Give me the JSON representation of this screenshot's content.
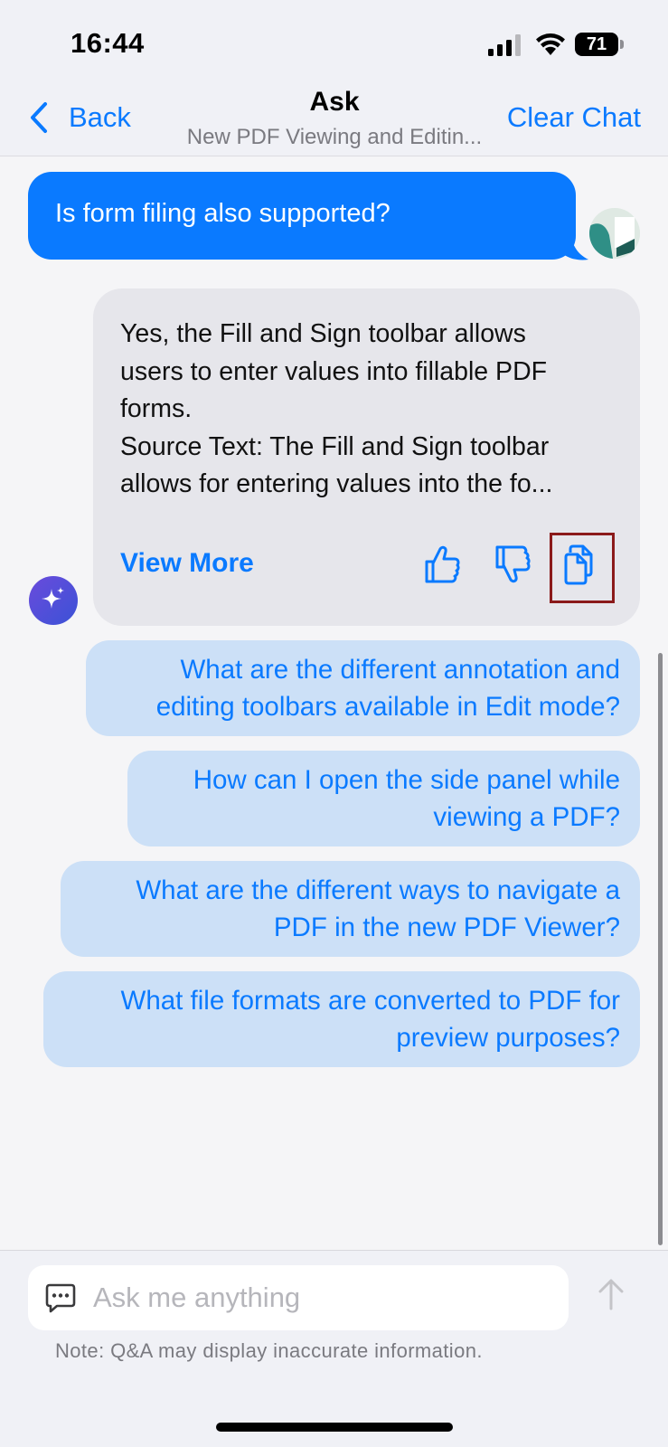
{
  "status": {
    "time": "16:44",
    "battery": "71"
  },
  "nav": {
    "back_label": "Back",
    "title": "Ask",
    "subtitle": "New PDF Viewing and Editin...",
    "clear_label": "Clear Chat"
  },
  "messages": {
    "user": "Is form filing also supported?",
    "bot": {
      "lines": [
        "Yes, the Fill and Sign toolbar allows",
        "users to enter values into fillable PDF",
        "forms.",
        "Source Text: The Fill and Sign toolbar",
        "allows for entering values into the fo..."
      ],
      "view_more": "View More"
    }
  },
  "suggestions": [
    {
      "line1": "What are the different annotation and",
      "line2": "editing toolbars available in Edit mode?"
    },
    {
      "line1": "How can I open the side panel while",
      "line2": "viewing a PDF?"
    },
    {
      "line1": "What are the different ways to navigate a",
      "line2": "PDF in the new PDF Viewer?"
    },
    {
      "line1": "What file formats are converted to PDF for",
      "line2": "preview purposes?"
    }
  ],
  "input": {
    "placeholder": "Ask me anything",
    "value": ""
  },
  "note": "Note: Q&A may display inaccurate information.",
  "colors": {
    "accent": "#0a7aff",
    "suggestion_bg": "#cce0f7",
    "bot_bubble": "#e6e6eb",
    "highlight": "#8b1a1a"
  }
}
